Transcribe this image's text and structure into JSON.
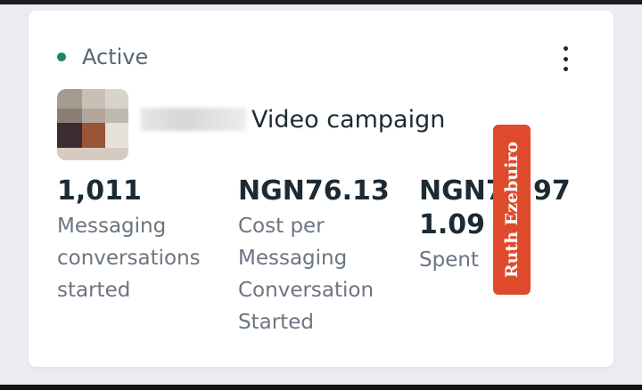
{
  "campaign": {
    "status": "Active",
    "title": "Video campaign"
  },
  "metrics": [
    {
      "value": "1,011",
      "label": "Messaging conversations started"
    },
    {
      "value": "NGN76.13",
      "label": "Cost per Messaging Conversation Started"
    },
    {
      "value": "NGN76,971.09",
      "label": "Spent"
    }
  ],
  "watermark": "Ruth Ezebuiro",
  "colors": {
    "active_dot": "#1a8a5c",
    "watermark_bg": "#e04a2c",
    "text_primary": "#1c2b33",
    "text_secondary": "#6b7580"
  },
  "icons": {
    "menu": "more-vertical-icon"
  }
}
